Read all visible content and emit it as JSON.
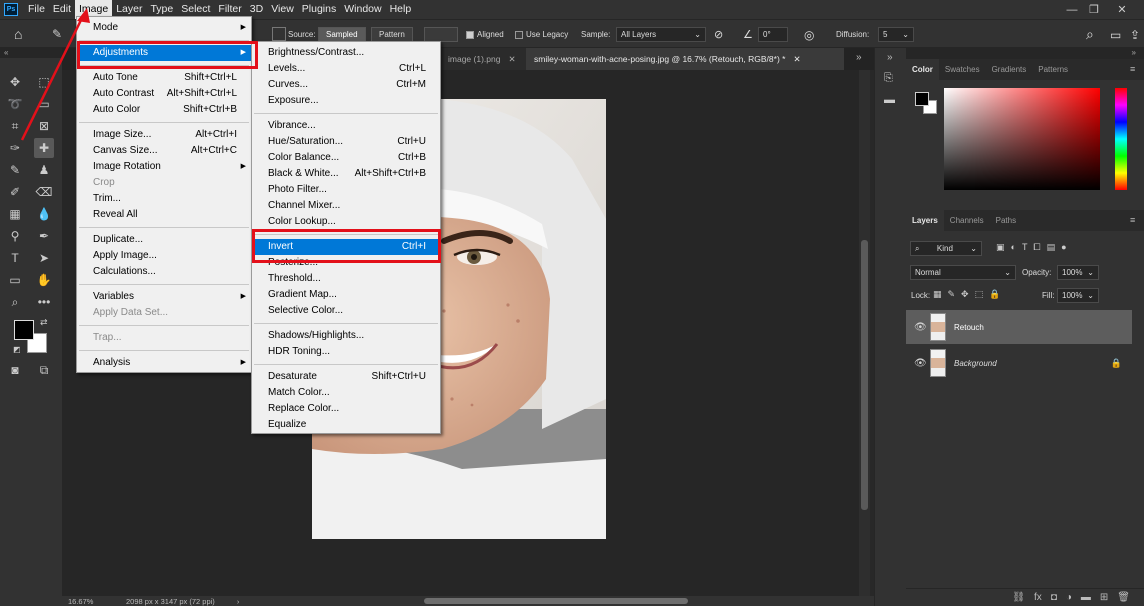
{
  "app": {
    "logo": "Ps"
  },
  "menubar": {
    "items": [
      "File",
      "Edit",
      "Image",
      "Layer",
      "Type",
      "Select",
      "Filter",
      "3D",
      "View",
      "Plugins",
      "Window",
      "Help"
    ],
    "active": "Image"
  },
  "options": {
    "source_label": "Source:",
    "sampled_label": "Sampled",
    "pattern_label": "Pattern",
    "aligned_label": "Aligned",
    "use_legacy_label": "Use Legacy",
    "sample_label": "Sample:",
    "sample_value": "All Layers",
    "angle_value": "0°",
    "diffusion_label": "Diffusion:",
    "diffusion_value": "5"
  },
  "tabs": [
    {
      "label": "image (1).png",
      "active": false
    },
    {
      "label": "smiley-woman-with-acne-posing.jpg @ 16.7% (Retouch, RGB/8*) *",
      "active": true
    }
  ],
  "status": {
    "zoom": "16.67%",
    "doc_info": "2098 px x 3147 px (72 ppi)"
  },
  "image_menu": [
    {
      "label": "Mode",
      "submenu": true
    },
    {
      "sep": true
    },
    {
      "label": "Adjustments",
      "submenu": true,
      "highlight": true
    },
    {
      "sep": true
    },
    {
      "label": "Auto Tone",
      "shortcut": "Shift+Ctrl+L"
    },
    {
      "label": "Auto Contrast",
      "shortcut": "Alt+Shift+Ctrl+L"
    },
    {
      "label": "Auto Color",
      "shortcut": "Shift+Ctrl+B"
    },
    {
      "sep": true
    },
    {
      "label": "Image Size...",
      "shortcut": "Alt+Ctrl+I"
    },
    {
      "label": "Canvas Size...",
      "shortcut": "Alt+Ctrl+C"
    },
    {
      "label": "Image Rotation",
      "submenu": true
    },
    {
      "label": "Crop",
      "disabled": true
    },
    {
      "label": "Trim..."
    },
    {
      "label": "Reveal All"
    },
    {
      "sep": true
    },
    {
      "label": "Duplicate..."
    },
    {
      "label": "Apply Image..."
    },
    {
      "label": "Calculations..."
    },
    {
      "sep": true
    },
    {
      "label": "Variables",
      "submenu": true
    },
    {
      "label": "Apply Data Set...",
      "disabled": true
    },
    {
      "sep": true
    },
    {
      "label": "Trap...",
      "disabled": true
    },
    {
      "sep": true
    },
    {
      "label": "Analysis",
      "submenu": true
    }
  ],
  "adjustments_menu": [
    {
      "label": "Brightness/Contrast..."
    },
    {
      "label": "Levels...",
      "shortcut": "Ctrl+L"
    },
    {
      "label": "Curves...",
      "shortcut": "Ctrl+M"
    },
    {
      "label": "Exposure..."
    },
    {
      "sep": true
    },
    {
      "label": "Vibrance..."
    },
    {
      "label": "Hue/Saturation...",
      "shortcut": "Ctrl+U"
    },
    {
      "label": "Color Balance...",
      "shortcut": "Ctrl+B"
    },
    {
      "label": "Black & White...",
      "shortcut": "Alt+Shift+Ctrl+B"
    },
    {
      "label": "Photo Filter..."
    },
    {
      "label": "Channel Mixer..."
    },
    {
      "label": "Color Lookup..."
    },
    {
      "sep": true
    },
    {
      "label": "Invert",
      "shortcut": "Ctrl+I",
      "highlight": true
    },
    {
      "label": "Posterize..."
    },
    {
      "label": "Threshold..."
    },
    {
      "label": "Gradient Map..."
    },
    {
      "label": "Selective Color..."
    },
    {
      "sep": true
    },
    {
      "label": "Shadows/Highlights..."
    },
    {
      "label": "HDR Toning..."
    },
    {
      "sep": true
    },
    {
      "label": "Desaturate",
      "shortcut": "Shift+Ctrl+U"
    },
    {
      "label": "Match Color..."
    },
    {
      "label": "Replace Color..."
    },
    {
      "label": "Equalize"
    }
  ],
  "color_panel": {
    "tabs": [
      "Color",
      "Swatches",
      "Gradients",
      "Patterns"
    ],
    "active": "Color",
    "hue_color": "#ff0000"
  },
  "layers_panel": {
    "tabs": [
      "Layers",
      "Channels",
      "Paths"
    ],
    "active": "Layers",
    "filter_kind": "Kind",
    "blend_mode": "Normal",
    "opacity_label": "Opacity:",
    "opacity_value": "100%",
    "lock_label": "Lock:",
    "fill_label": "Fill:",
    "fill_value": "100%",
    "layers": [
      {
        "name": "Retouch",
        "selected": true,
        "locked": false
      },
      {
        "name": "Background",
        "selected": false,
        "locked": true
      }
    ]
  },
  "colors": {
    "highlight": "#0078d7",
    "annotation": "#e3101a",
    "menu_bg": "#f0f0f0",
    "app_bg": "#323232"
  }
}
